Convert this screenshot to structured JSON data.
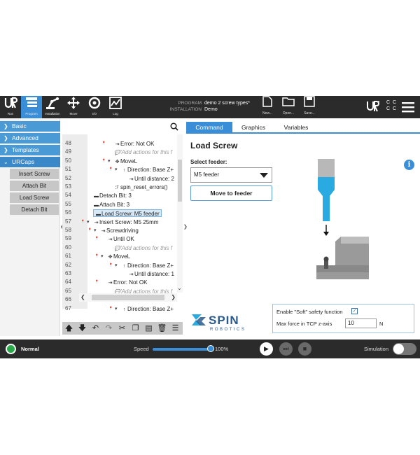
{
  "header": {
    "nav": [
      {
        "label": "Run",
        "icon": "ur-logo-icon"
      },
      {
        "label": "Program",
        "icon": "program-icon"
      },
      {
        "label": "Installation",
        "icon": "robot-arm-icon"
      },
      {
        "label": "Move",
        "icon": "move-arrows-icon"
      },
      {
        "label": "I/O",
        "icon": "io-icon"
      },
      {
        "label": "Log",
        "icon": "log-chart-icon"
      }
    ],
    "program_key": "PROGRAM",
    "program_value": "demo 2 screw types*",
    "installation_key": "INSTALLATION",
    "installation_value": "Demo",
    "file_buttons": [
      "New...",
      "Open...",
      "Save..."
    ],
    "ccc": [
      "C C",
      "C C"
    ]
  },
  "sidebar": {
    "categories": [
      "Basic",
      "Advanced",
      "Templates",
      "URCaps"
    ],
    "urcaps_items": [
      "Insert Screw",
      "Attach Bit",
      "Load Screw",
      "Detach Bit"
    ]
  },
  "tree": {
    "lines": [
      {
        "n": "48",
        "text": "Error: Not OK"
      },
      {
        "n": "49",
        "text": "'Add actions for this f"
      },
      {
        "n": "50",
        "text": "MoveL"
      },
      {
        "n": "51",
        "text": "Direction: Base Z+"
      },
      {
        "n": "52",
        "text": "Until distance: 2"
      },
      {
        "n": "53",
        "text": "spin_reset_errors()"
      },
      {
        "n": "54",
        "text": "Detach Bit: 3"
      },
      {
        "n": "55",
        "text": "Attach Bit: 3"
      },
      {
        "n": "56",
        "text": "Load Screw: M5 feeder"
      },
      {
        "n": "57",
        "text": "Insert Screw: M5 25mm"
      },
      {
        "n": "58",
        "text": "Screwdriving"
      },
      {
        "n": "59",
        "text": "Until OK"
      },
      {
        "n": "60",
        "text": "'Add actions for this f"
      },
      {
        "n": "61",
        "text": "MoveL"
      },
      {
        "n": "62",
        "text": "Direction: Base Z+"
      },
      {
        "n": "63",
        "text": "Until distance: 1"
      },
      {
        "n": "64",
        "text": "Error: Not OK"
      },
      {
        "n": "65",
        "text": "'Add actions for this f"
      },
      {
        "n": "66",
        "text": "MoveL"
      },
      {
        "n": "67",
        "text": "Direction: Base Z+"
      }
    ]
  },
  "tabs": [
    "Command",
    "Graphics",
    "Variables"
  ],
  "command": {
    "title": "Load Screw",
    "feeder_label": "Select feeder:",
    "feeder_value": "M5 feeder",
    "move_button": "Move to feeder",
    "soft_safety_label": "Enable \"Soft\" safety function",
    "soft_safety_checked": true,
    "max_force_label": "Max force in TCP z-axis",
    "max_force_value": "10",
    "max_force_unit": "N",
    "logo_name": "SPIN",
    "logo_sub": "ROBOTICS"
  },
  "footer": {
    "status": "Normal",
    "speed_label": "Speed",
    "speed_value": "100%",
    "speed_fraction": 1.0,
    "simulation_label": "Simulation",
    "simulation_on": false
  },
  "colors": {
    "accent": "#3a8ed8",
    "header_bg": "#2b2b2b",
    "status_ok": "#2aa84a",
    "feeder_blue": "#29aae1"
  }
}
